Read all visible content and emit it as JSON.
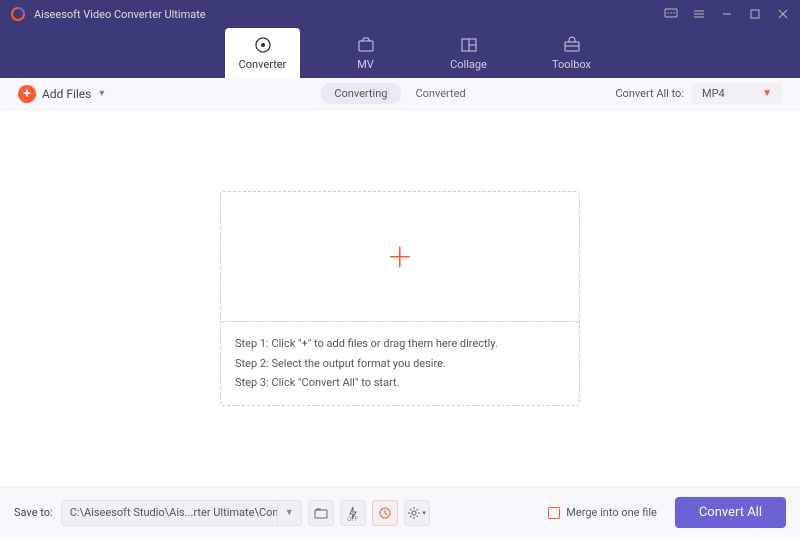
{
  "titlebar": {
    "title": "Aiseesoft Video Converter Ultimate"
  },
  "tabs": {
    "converter": "Converter",
    "mv": "MV",
    "collage": "Collage",
    "toolbox": "Toolbox"
  },
  "toolbar": {
    "add_files": "Add Files",
    "converting": "Converting",
    "converted": "Converted",
    "convert_all_to": "Convert All to:",
    "format": "MP4"
  },
  "dropzone": {
    "step1": "Step 1: Click \"+\" to add files or drag them here directly.",
    "step2": "Step 2: Select the output format you desire.",
    "step3": "Step 3: Click \"Convert All\" to start."
  },
  "bottom": {
    "save_to": "Save to:",
    "path": "C:\\Aiseesoft Studio\\Ais...rter Ultimate\\Converted",
    "merge": "Merge into one file",
    "convert_all": "Convert All"
  }
}
